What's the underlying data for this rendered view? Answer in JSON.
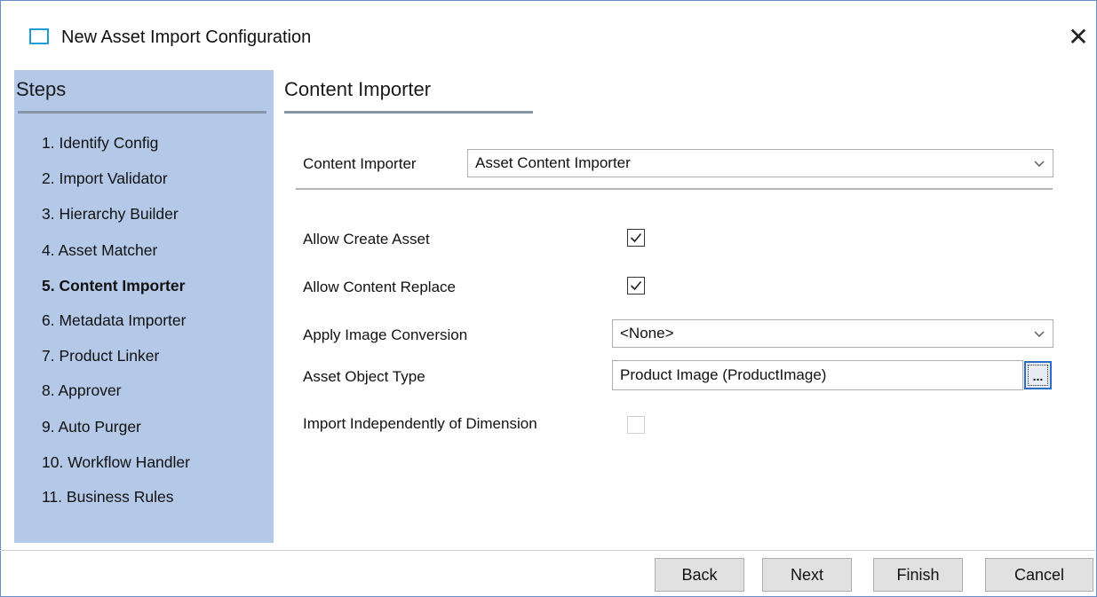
{
  "window": {
    "title": "New Asset Import Configuration",
    "close_glyph": "✕"
  },
  "steps": {
    "header": "Steps",
    "items": [
      {
        "label": "1. Identify Config",
        "current": false
      },
      {
        "label": "2. Import Validator",
        "current": false
      },
      {
        "label": "3. Hierarchy Builder",
        "current": false
      },
      {
        "label": "4. Asset Matcher",
        "current": false
      },
      {
        "label": "5. Content Importer",
        "current": true
      },
      {
        "label": "6. Metadata Importer",
        "current": false
      },
      {
        "label": "7. Product Linker",
        "current": false
      },
      {
        "label": "8. Approver",
        "current": false
      },
      {
        "label": "9. Auto Purger",
        "current": false
      },
      {
        "label": "10. Workflow Handler",
        "current": false
      },
      {
        "label": "11. Business Rules",
        "current": false
      }
    ]
  },
  "content": {
    "header": "Content Importer",
    "importer": {
      "label": "Content Importer",
      "value": "Asset Content Importer"
    },
    "allow_create_asset": {
      "label": "Allow Create Asset",
      "checked": true
    },
    "allow_content_replace": {
      "label": "Allow Content Replace",
      "checked": true
    },
    "apply_image_conversion": {
      "label": "Apply Image Conversion",
      "value": "<None>"
    },
    "asset_object_type": {
      "label": "Asset Object Type",
      "value": "Product Image (ProductImage)",
      "browse_label": "..."
    },
    "import_independently": {
      "label": "Import Independently of Dimension",
      "checked": false,
      "enabled": false
    }
  },
  "buttons": {
    "back": "Back",
    "next": "Next",
    "finish": "Finish",
    "cancel": "Cancel"
  },
  "colors": {
    "steps_bg": "#b4c8e8",
    "accent": "#1f9bd6",
    "button_bg": "#e1e1e1"
  }
}
